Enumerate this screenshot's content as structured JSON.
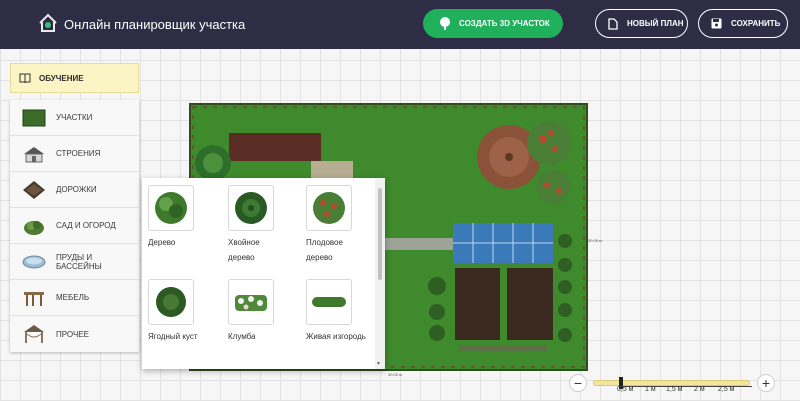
{
  "header": {
    "title": "Онлайн планировщик участка",
    "create_3d_label": "СОЗДАТЬ 3D УЧАСТОК",
    "new_plan_label": "НОВЫЙ ПЛАН",
    "save_label": "СОХРАНИТЬ"
  },
  "tutorial_label": "ОБУЧЕНИЕ",
  "sidebar": {
    "items": [
      {
        "label": "УЧАСТКИ",
        "icon": "plot-icon"
      },
      {
        "label": "СТРОЕНИЯ",
        "icon": "house-icon"
      },
      {
        "label": "ДОРОЖКИ",
        "icon": "paving-icon"
      },
      {
        "label": "САД И ОГОРОД",
        "icon": "shrub-icon"
      },
      {
        "label": "ПРУДЫ И БАССЕЙНЫ",
        "icon": "pool-icon"
      },
      {
        "label": "МЕБЕЛЬ",
        "icon": "table-icon"
      },
      {
        "label": "ПРОЧЕЕ",
        "icon": "gazebo-icon"
      }
    ]
  },
  "panel": {
    "items": [
      {
        "label": "Дерево",
        "icon": "tree-icon"
      },
      {
        "label": "Хвойное дерево",
        "icon": "conifer-icon"
      },
      {
        "label": "Плодовое дерево",
        "icon": "fruit-tree-icon"
      },
      {
        "label": "Ягодный куст",
        "icon": "berry-bush-icon"
      },
      {
        "label": "Клумба",
        "icon": "flowerbed-icon"
      },
      {
        "label": "Живая изгородь",
        "icon": "hedge-icon"
      }
    ]
  },
  "plot": {
    "dim_right": "20.00 м",
    "dim_bottom": "30.00 м"
  },
  "zoom": {
    "scale_labels": [
      "0,5 м",
      "1 м",
      "1,5 м",
      "2 м",
      "2,5 м"
    ]
  },
  "colors": {
    "header_bg": "#2f2d45",
    "accent_green": "#1fb05c",
    "lawn": "#3f8a2c"
  }
}
